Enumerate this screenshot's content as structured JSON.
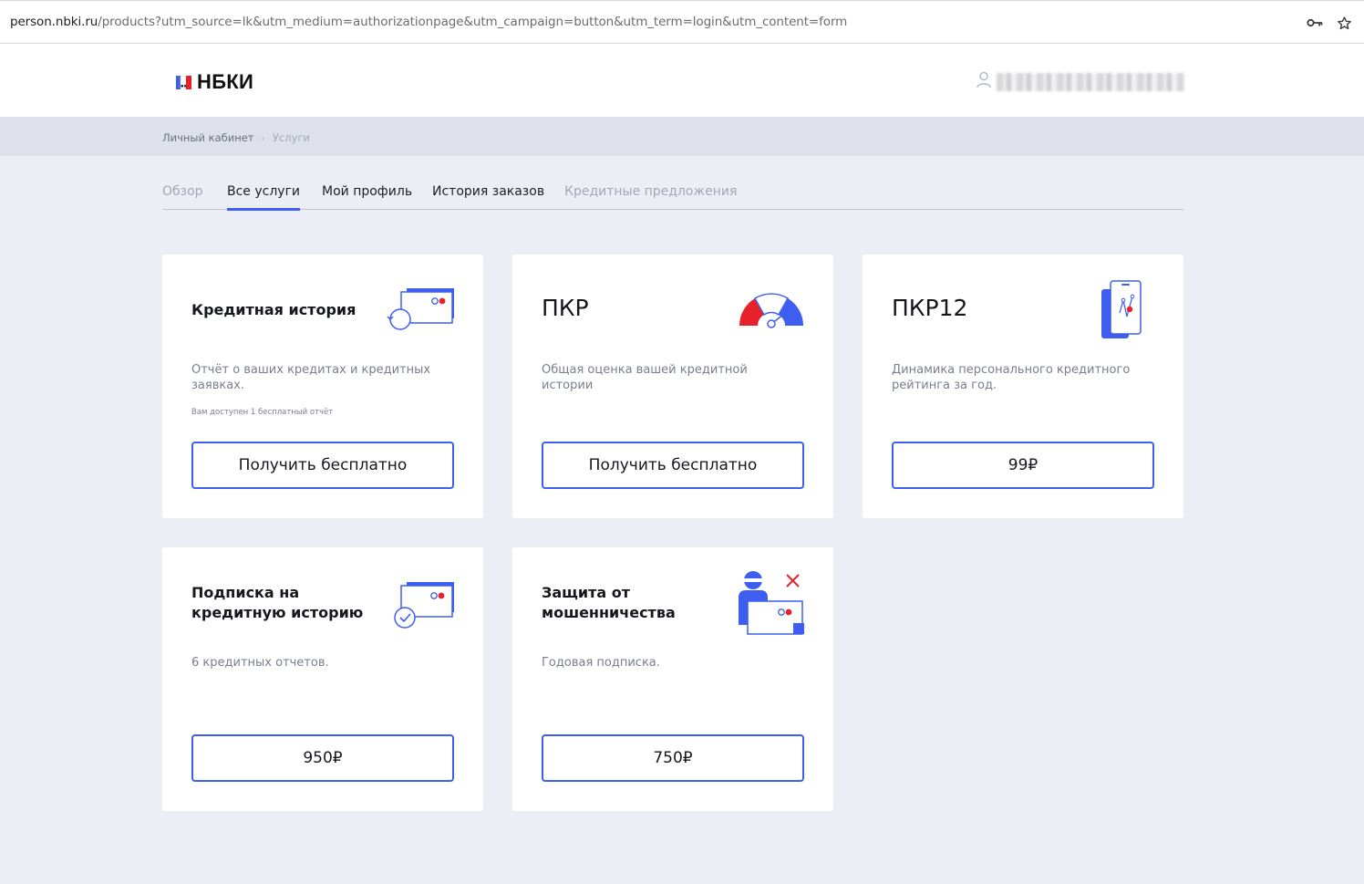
{
  "browser": {
    "url_domain": "person.nbki.ru",
    "url_path": "/products?utm_source=lk&utm_medium=authorizationpage&utm_campaign=button&utm_term=login&utm_content=form",
    "icons": [
      "key-icon",
      "star-icon"
    ]
  },
  "header": {
    "logo_text": "НБКИ",
    "user_icon": "user-icon"
  },
  "breadcrumbs": [
    "Личный кабинет",
    "Услуги"
  ],
  "tabs": [
    {
      "label": "Обзор",
      "state": "muted"
    },
    {
      "label": "Все услуги",
      "state": "active"
    },
    {
      "label": "Мой профиль",
      "state": "normal"
    },
    {
      "label": "История заказов",
      "state": "normal"
    },
    {
      "label": "Кредитные предложения",
      "state": "muted"
    }
  ],
  "cards": [
    {
      "title": "Кредитная история",
      "description": "Отчёт о ваших кредитах и кредитных заявках.",
      "note": "Вам доступен 1 бесплатный отчёт",
      "button": "Получить бесплатно",
      "icon": "credit-card-refresh-icon"
    },
    {
      "title": "ПКР",
      "description": "Общая оценка вашей кредитной истории",
      "note": "",
      "button": "Получить бесплатно",
      "icon": "speedometer-icon"
    },
    {
      "title": "ПКР12",
      "description": "Динамика персонального кредитного рейтинга за год.",
      "note": "",
      "button": "99₽",
      "icon": "phone-chart-icon"
    },
    {
      "title": "Подписка на кредитную историю",
      "description": "6 кредитных отчетов.",
      "note": "",
      "button": "950₽",
      "icon": "credit-card-check-icon"
    },
    {
      "title": "Защита от мошенничества",
      "description": "Годовая подписка.",
      "note": "",
      "button": "750₽",
      "icon": "fraud-protection-icon"
    }
  ],
  "colors": {
    "accent": "#3d5ef0",
    "alert_red": "#e8202a",
    "page_bg": "#eceef5",
    "crumb_bg": "#dee0eb"
  }
}
